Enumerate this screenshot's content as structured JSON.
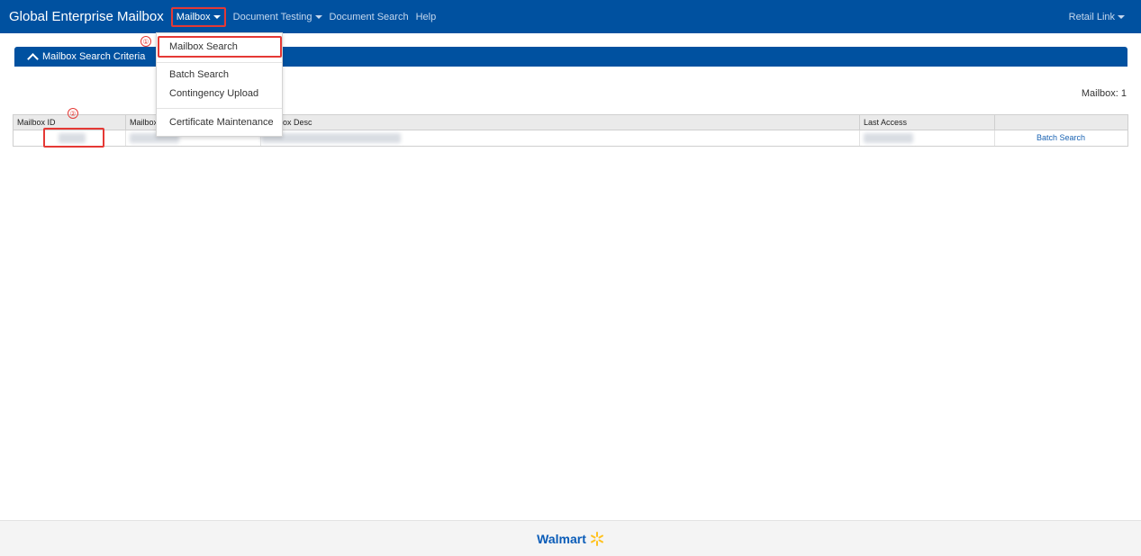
{
  "navbar": {
    "brand": "Global Enterprise Mailbox",
    "items": [
      {
        "label": "Mailbox",
        "has_caret": true
      },
      {
        "label": "Document Testing",
        "has_caret": true
      },
      {
        "label": "Document Search",
        "has_caret": false
      },
      {
        "label": "Help",
        "has_caret": false
      }
    ],
    "right": {
      "label": "Retail Link"
    }
  },
  "dropdown": {
    "items": [
      {
        "label": "Mailbox Search"
      },
      {
        "label": "Batch Search"
      },
      {
        "label": "Contingency Upload"
      },
      {
        "label": "Certificate Maintenance"
      }
    ]
  },
  "markers": {
    "one": "①",
    "two": "②"
  },
  "criteria": {
    "label": "Mailbox Search Criteria"
  },
  "result_count": "Mailbox: 1",
  "table": {
    "headers": [
      "Mailbox ID",
      "Mailbox",
      "ox Desc",
      "Last Access",
      ""
    ],
    "rows": [
      {
        "action_label": "Batch Search"
      }
    ]
  },
  "footer": {
    "logo": "Walmart"
  },
  "colors": {
    "primary": "#0051a0",
    "highlight": "#e53935",
    "logo_spark": "#ffc220"
  }
}
